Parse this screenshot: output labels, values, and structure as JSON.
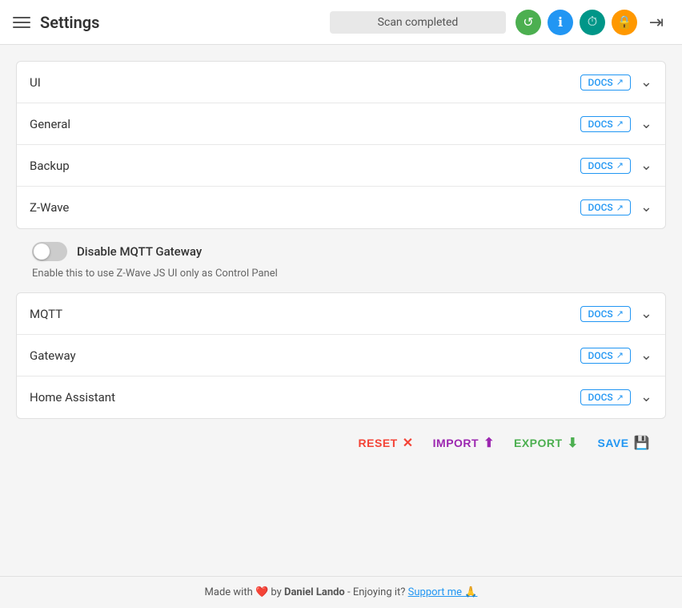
{
  "header": {
    "menu_label": "menu",
    "title": "Settings",
    "scan_status": "Scan completed",
    "icons": [
      {
        "name": "refresh-icon",
        "symbol": "↺",
        "color": "icon-green",
        "label": "Refresh"
      },
      {
        "name": "info-icon",
        "symbol": "ℹ",
        "color": "icon-blue",
        "label": "Info"
      },
      {
        "name": "history-icon",
        "symbol": "⏱",
        "color": "icon-teal",
        "label": "History"
      },
      {
        "name": "lock-icon",
        "symbol": "🔒",
        "color": "icon-yellow",
        "label": "Lock"
      },
      {
        "name": "exit-icon",
        "symbol": "⇥",
        "color": "icon-exit",
        "label": "Exit"
      }
    ]
  },
  "settings": {
    "rows": [
      {
        "id": "ui",
        "label": "UI",
        "docs": "DOCS"
      },
      {
        "id": "general",
        "label": "General",
        "docs": "DOCS"
      },
      {
        "id": "backup",
        "label": "Backup",
        "docs": "DOCS"
      },
      {
        "id": "zwave",
        "label": "Z-Wave",
        "docs": "DOCS"
      }
    ]
  },
  "mqtt_gateway": {
    "toggle_label": "Disable MQTT Gateway",
    "toggle_desc": "Enable this to use Z-Wave JS UI only as Control Panel",
    "enabled": false
  },
  "mqtt_rows": [
    {
      "id": "mqtt",
      "label": "MQTT",
      "docs": "DOCS"
    },
    {
      "id": "gateway",
      "label": "Gateway",
      "docs": "DOCS"
    },
    {
      "id": "home_assistant",
      "label": "Home Assistant",
      "docs": "DOCS"
    }
  ],
  "actions": {
    "reset": "RESET",
    "import": "IMPORT",
    "export": "EXPORT",
    "save": "SAVE"
  },
  "footer": {
    "made_with": "Made with",
    "by": "by",
    "author": "Daniel Lando",
    "enjoying": " - Enjoying it?",
    "support": "Support me 🙏"
  }
}
